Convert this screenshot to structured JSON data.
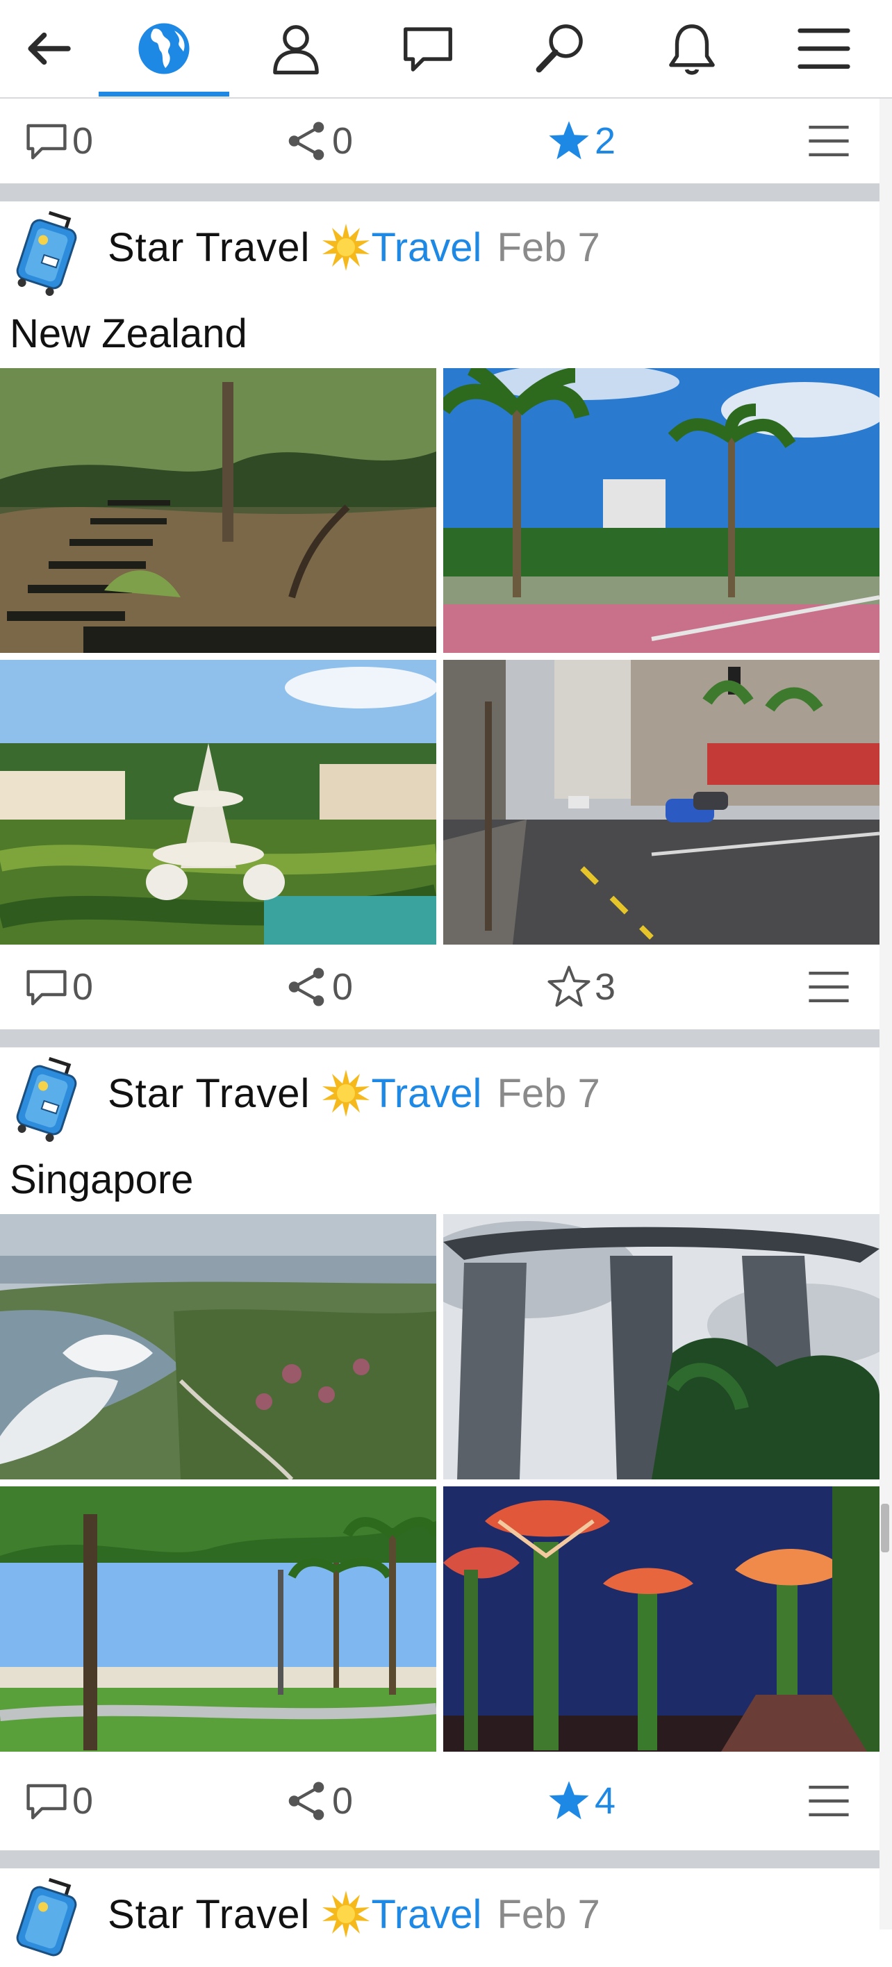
{
  "nav": {
    "items": [
      "back-icon",
      "globe-icon",
      "profile-icon",
      "chat-icon",
      "search-icon",
      "bell-icon",
      "menu-icon"
    ],
    "active": "globe-icon",
    "accent_color": "#1e88e5"
  },
  "top_actions": {
    "comments": "0",
    "shares": "0",
    "stars": "2",
    "starred": true
  },
  "posts": [
    {
      "author": "Star Travel",
      "community": "Travel",
      "date": "Feb 7",
      "title": "New Zealand",
      "photos": [
        "forest-steps-photo",
        "palm-park-photo",
        "garden-fountain-photo",
        "city-street-photo"
      ],
      "actions": {
        "comments": "0",
        "shares": "0",
        "stars": "3",
        "starred": false
      }
    },
    {
      "author": "Star Travel",
      "community": "Travel",
      "date": "Feb 7",
      "title": "Singapore",
      "photos": [
        "gardens-by-the-bay-aerial-photo",
        "marina-bay-sands-photo",
        "beach-park-photo",
        "supertree-grove-night-photo"
      ],
      "actions": {
        "comments": "0",
        "shares": "0",
        "stars": "4",
        "starred": true
      }
    },
    {
      "author": "Star Travel",
      "community": "Travel",
      "date": "Feb 7"
    }
  ]
}
